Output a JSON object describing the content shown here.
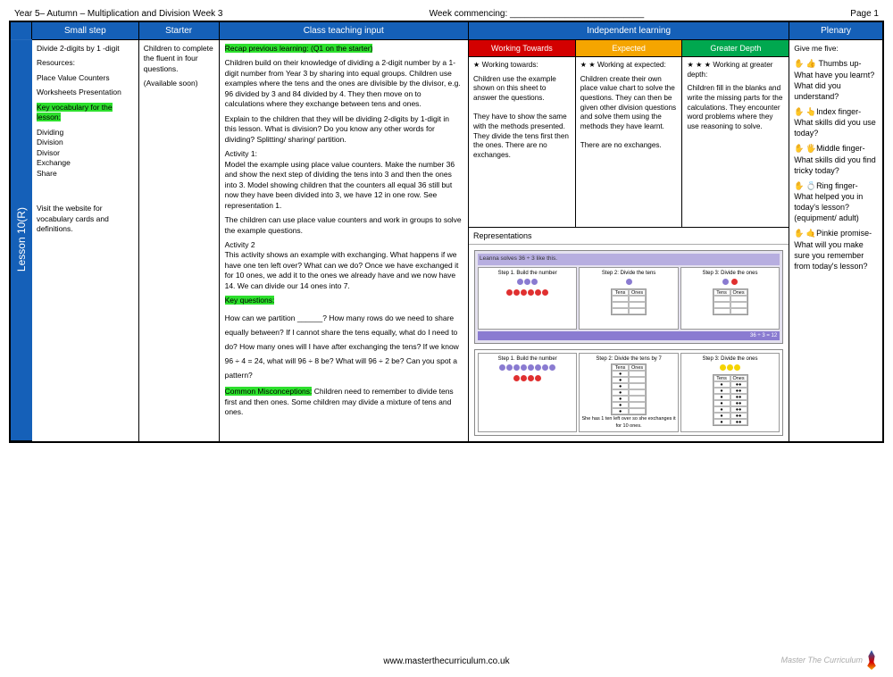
{
  "meta": {
    "title_left": "Year 5– Autumn – Multiplication and Division Week 3",
    "title_mid": "Week commencing: ___________________________",
    "title_right": "Page 1",
    "footer_url": "www.masterthecurriculum.co.uk",
    "footer_brand": "Master The Curriculum"
  },
  "headers": {
    "step": "Small step",
    "starter": "Starter",
    "input": "Class teaching input",
    "indep": "Independent learning",
    "plenary": "Plenary"
  },
  "lesson_label": "Lesson 10(R)",
  "small_step": {
    "title": "Divide 2-digits by 1 -digit",
    "res_label": "Resources:",
    "res1": "Place Value Counters",
    "res2": "Worksheets Presentation",
    "vocab_label": "Key vocabulary for the lesson:",
    "vocab": "Dividing\nDivision\nDivisor\nExchange\nShare",
    "note": "Visit the website for vocabulary cards and definitions."
  },
  "starter": {
    "line1": "Children to complete the fluent in four questions.",
    "line2": "(Available soon)"
  },
  "input": {
    "recap": "Recap previous learning: (Q1 on the starter)",
    "p1": "Children build on their knowledge of dividing a 2-digit number by a 1-digit number from Year 3 by sharing into equal groups. Children use examples where the tens and the ones are divisible by the divisor, e.g. 96 divided by 3 and 84 divided by 4. They then move on to calculations where they exchange between tens and ones.",
    "p2": "Explain to the children that they will be dividing 2-digits by 1-digit in this lesson. What is division? Do you know any other words for dividing? Splitting/ sharing/ partition.",
    "a1_label": "Activity 1:",
    "a1": "Model the example using place value counters. Make the number 36 and show the next step of dividing the tens into 3 and then the ones into 3. Model showing children that the counters all equal 36 still but now they have been divided into 3, we have 12 in one row. See representation 1.",
    "a1b": "The children can use place value counters and work in groups to solve the example questions.",
    "a2_label": "Activity 2",
    "a2": "This activity shows an example with exchanging. What happens if we have one ten left over? What can we do? Once we have exchanged it for 10 ones, we add it to the ones we already have and we now have 14. We can divide our 14 ones into 7.",
    "kq_label": "Key questions:",
    "kq": "How can we partition ______? How many rows do we need to share equally between? If I cannot share the tens equally, what do I need to do? How many ones will I have after exchanging the tens? If we know 96 ÷ 4 = 24, what will 96 ÷ 8 be? What will 96 ÷ 2 be? Can you spot a pattern?",
    "miscon_label": "Common Misconceptions:",
    "miscon": " Children need to remember to divide tens first and then ones. Some children may divide a mixture of tens and ones."
  },
  "indep": {
    "wt_h": "Working Towards",
    "ex_h": "Expected",
    "gd_h": "Greater Depth",
    "wt_t": "★  Working towards:",
    "wt_b": "Children use the example shown on this sheet to answer the questions.\n\nThey have to show the same with the methods presented. They divide the tens first then the ones. There are no exchanges.",
    "ex_t": "★ ★ Working at expected:",
    "ex_b": "Children create their own place value chart to solve the questions. They can then be given other division questions and solve them using the methods they have learnt.\n\nThere are no exchanges.",
    "gd_t": "★ ★ ★ Working at greater depth:",
    "gd_b": "Children fill in the blanks and write the missing parts for the calculations. They encounter word problems where they use reasoning to solve.",
    "rep_label": "Representations",
    "mini1_title": "Leanna solves 36 ÷ 3 like this.",
    "mini1_s1": "Step 1. Build the number",
    "mini1_s2": "Step 2: Divide the tens",
    "mini1_s3": "Step 3: Divide the ones",
    "mini1_ans": "36 ÷ 3 = 12",
    "mini2_s1": "Step 1. Build the number",
    "mini2_s2": "Step 2: Divide the tens by 7",
    "mini2_s3": "Step 3: Divide the ones",
    "mini2_note": "She has 1 ten left over so she exchanges it for 10 ones."
  },
  "plenary": {
    "intro": "Give me five:",
    "thumb": "✋ 👍 Thumbs up- What have you learnt? What did you understand?",
    "index": "✋ 👆Index finger- What skills did you use today?",
    "middle": "✋ 🖐Middle finger- What skills did you find tricky today?",
    "ring": "✋ 💍Ring finger- What helped you in today's lesson? (equipment/ adult)",
    "pinkie": "✋ 🤙Pinkie promise- What will you make sure you remember from today's lesson?"
  }
}
